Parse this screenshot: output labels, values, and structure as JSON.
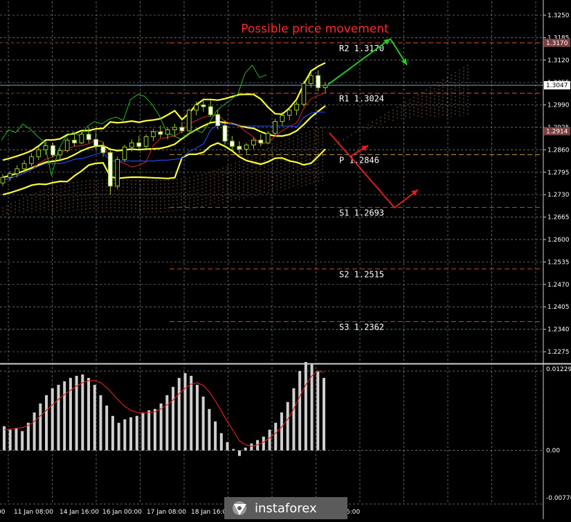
{
  "chart_data": {
    "type": "candlestick",
    "title": "Possible price movement",
    "price_axis": {
      "range": [
        1.2245,
        1.329
      ],
      "ticks": [
        "1.3250",
        "1.3185",
        "1.3120",
        "1.3055",
        "1.2990",
        "1.2925",
        "1.2860",
        "1.2795",
        "1.2730",
        "1.2665",
        "1.2600",
        "1.2535",
        "1.2470",
        "1.2405",
        "1.2340",
        "1.2275"
      ]
    },
    "current_price": "1.3047",
    "marker_price": "1.2914",
    "levels": [
      {
        "name": "R2",
        "label": "R2 1.3170",
        "price": 1.317,
        "color": "#e0522d"
      },
      {
        "name": "R1",
        "label": "R1 1.3024",
        "price": 1.3024,
        "color": "#e0522d"
      },
      {
        "name": "P",
        "label": "P 1.2846",
        "price": 1.2846,
        "color": "#c8a040"
      },
      {
        "name": "S1",
        "label": "S1 1.2693",
        "price": 1.2693,
        "color": "#c05030"
      },
      {
        "name": "S2",
        "label": "S2 1.2515",
        "price": 1.2515,
        "color": "#c05030"
      },
      {
        "name": "S3",
        "label": "S3 1.2362",
        "price": 1.2362,
        "color": "#c05030"
      }
    ],
    "time_axis": {
      "labels": [
        "00",
        "11 Jan 08:00",
        "14 Jan 16:00",
        "16 Jan 00:00",
        "17 Jan 08:00",
        "18 Jan 16:00",
        "6:00"
      ]
    },
    "candles_ohlc": [
      [
        1.2764,
        1.279,
        1.2755,
        1.278
      ],
      [
        1.278,
        1.2798,
        1.277,
        1.2791
      ],
      [
        1.2791,
        1.2815,
        1.278,
        1.2805
      ],
      [
        1.2805,
        1.283,
        1.2795,
        1.282
      ],
      [
        1.282,
        1.285,
        1.2812,
        1.284
      ],
      [
        1.284,
        1.287,
        1.283,
        1.286
      ],
      [
        1.286,
        1.2885,
        1.2845,
        1.2872
      ],
      [
        1.2872,
        1.288,
        1.2838,
        1.2845
      ],
      [
        1.2845,
        1.2865,
        1.283,
        1.2858
      ],
      [
        1.2858,
        1.2895,
        1.2852,
        1.2888
      ],
      [
        1.2888,
        1.291,
        1.287,
        1.288
      ],
      [
        1.288,
        1.2915,
        1.2876,
        1.2905
      ],
      [
        1.2905,
        1.2925,
        1.288,
        1.289
      ],
      [
        1.289,
        1.291,
        1.286,
        1.287
      ],
      [
        1.287,
        1.2882,
        1.284,
        1.2852
      ],
      [
        1.2852,
        1.286,
        1.273,
        1.2755
      ],
      [
        1.2755,
        1.284,
        1.2745,
        1.2832
      ],
      [
        1.2832,
        1.2875,
        1.2825,
        1.2868
      ],
      [
        1.2868,
        1.289,
        1.2855,
        1.288
      ],
      [
        1.288,
        1.29,
        1.2862,
        1.287
      ],
      [
        1.287,
        1.2905,
        1.2866,
        1.2898
      ],
      [
        1.2898,
        1.292,
        1.2885,
        1.2912
      ],
      [
        1.2912,
        1.293,
        1.2895,
        1.2905
      ],
      [
        1.2905,
        1.2925,
        1.289,
        1.2918
      ],
      [
        1.2918,
        1.2935,
        1.29,
        1.2925
      ],
      [
        1.2925,
        1.294,
        1.2908,
        1.2915
      ],
      [
        1.2915,
        1.298,
        1.2912,
        1.2975
      ],
      [
        1.2975,
        1.3,
        1.296,
        1.299
      ],
      [
        1.299,
        1.301,
        1.297,
        1.2985
      ],
      [
        1.2985,
        1.3005,
        1.2955,
        1.2962
      ],
      [
        1.2962,
        1.2975,
        1.292,
        1.293
      ],
      [
        1.293,
        1.2945,
        1.2875,
        1.2885
      ],
      [
        1.2885,
        1.29,
        1.286,
        1.287
      ],
      [
        1.287,
        1.2885,
        1.285,
        1.2862
      ],
      [
        1.2862,
        1.288,
        1.2848,
        1.2874
      ],
      [
        1.2874,
        1.2895,
        1.2862,
        1.2888
      ],
      [
        1.2888,
        1.2905,
        1.287,
        1.288
      ],
      [
        1.288,
        1.2915,
        1.2876,
        1.2908
      ],
      [
        1.2908,
        1.295,
        1.29,
        1.2942
      ],
      [
        1.2942,
        1.297,
        1.293,
        1.296
      ],
      [
        1.296,
        1.2985,
        1.2945,
        1.2975
      ],
      [
        1.2975,
        1.3,
        1.296,
        1.2992
      ],
      [
        1.2992,
        1.306,
        1.2985,
        1.3052
      ],
      [
        1.3052,
        1.3085,
        1.304,
        1.3075
      ],
      [
        1.3075,
        1.309,
        1.303,
        1.304
      ],
      [
        1.304,
        1.3055,
        1.3025,
        1.3047
      ]
    ],
    "indicator": {
      "axis_ticks": [
        "0.01229",
        "0.00",
        "-0.00776"
      ],
      "range": [
        -0.00776,
        0.01229
      ],
      "histogram": [
        0.0035,
        0.003,
        0.0032,
        0.0028,
        0.004,
        0.0055,
        0.0068,
        0.008,
        0.009,
        0.0095,
        0.01,
        0.0105,
        0.0108,
        0.011,
        0.0105,
        0.0095,
        0.008,
        0.0065,
        0.005,
        0.004,
        0.0045,
        0.0048,
        0.005,
        0.0055,
        0.0058,
        0.006,
        0.0068,
        0.008,
        0.0092,
        0.0105,
        0.0112,
        0.0108,
        0.0095,
        0.0078,
        0.006,
        0.0042,
        0.0025,
        0.0012,
        0.0002,
        -0.0008,
        0.0004,
        0.001,
        0.0015,
        0.002,
        0.003,
        0.004,
        0.0055,
        0.007,
        0.009,
        0.0115,
        0.0128,
        0.0125,
        0.0115,
        0.0105
      ],
      "signal": [
        0.003,
        0.0031,
        0.0032,
        0.0033,
        0.0036,
        0.0042,
        0.005,
        0.0058,
        0.0066,
        0.0074,
        0.0081,
        0.0087,
        0.0093,
        0.0098,
        0.0101,
        0.0101,
        0.0098,
        0.0091,
        0.0082,
        0.0072,
        0.0064,
        0.0058,
        0.0055,
        0.0054,
        0.0055,
        0.0056,
        0.006,
        0.0066,
        0.0073,
        0.0082,
        0.009,
        0.0096,
        0.0098,
        0.0094,
        0.0085,
        0.0072,
        0.0057,
        0.0042,
        0.0028,
        0.0014,
        0.0008,
        0.0006,
        0.0008,
        0.0012,
        0.0018,
        0.0025,
        0.0034,
        0.0045,
        0.006,
        0.0078,
        0.0095,
        0.0108,
        0.0115,
        0.0113
      ]
    },
    "scenarios": {
      "bullish_color": "#22cc22",
      "bearish_color": "#e01e1e"
    },
    "colors": {
      "background": "#000000",
      "grid": "#8a8a8a",
      "bollinger": "#ffff33",
      "tenkan": "#d02020",
      "kijun": "#2050ff",
      "chikou": "#20c020",
      "cloud": "#c8906a",
      "title": "#ff2b2b"
    }
  },
  "branding": {
    "logo_text": "instaforex"
  }
}
